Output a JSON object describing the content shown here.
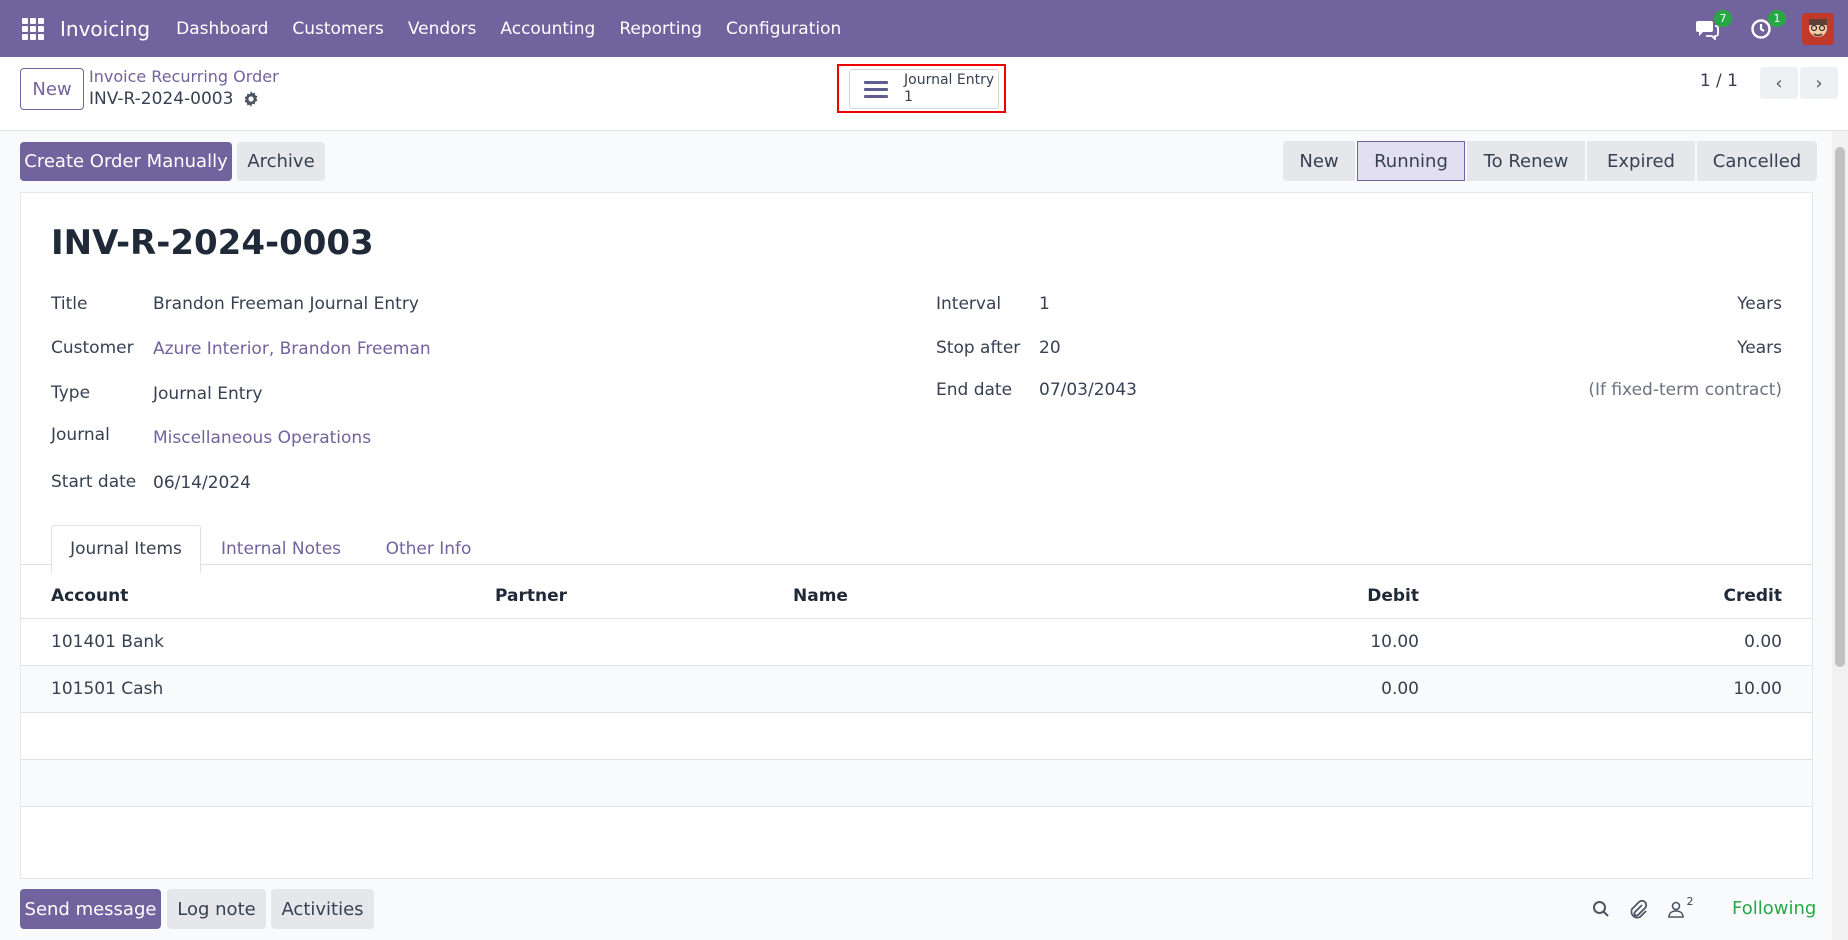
{
  "navbar": {
    "brand": "Invoicing",
    "menu": [
      "Dashboard",
      "Customers",
      "Vendors",
      "Accounting",
      "Reporting",
      "Configuration"
    ],
    "messages_count": "7",
    "activities_count": "1",
    "color": "#71639e"
  },
  "control_panel": {
    "new_label": "New",
    "breadcrumb": "Invoice Recurring Order",
    "record_name": "INV-R-2024-0003",
    "smart_button": {
      "label": "Journal Entry",
      "count": "1"
    },
    "pager": "1 / 1"
  },
  "actions": {
    "create_order": "Create Order Manually",
    "archive": "Archive"
  },
  "statusbar": {
    "stages": [
      "New",
      "Running",
      "To Renew",
      "Expired",
      "Cancelled"
    ],
    "active": "Running"
  },
  "form": {
    "title": "INV-R-2024-0003",
    "left_fields": [
      {
        "label": "Title",
        "value": "Brandon Freeman Journal Entry"
      },
      {
        "label": "Customer",
        "value": "Azure Interior, Brandon Freeman"
      },
      {
        "label": "Type",
        "value": "Journal Entry"
      },
      {
        "label": "Journal",
        "value": "Miscellaneous Operations"
      },
      {
        "label": "Start date",
        "value": "06/14/2024"
      }
    ],
    "right_fields": [
      {
        "label": "Interval",
        "value": "1",
        "unit": "Years"
      },
      {
        "label": "Stop after",
        "value": "20",
        "unit": "Years"
      },
      {
        "label": "End date",
        "value": "07/03/2043",
        "unit": "(If fixed-term contract)"
      }
    ]
  },
  "tabs": [
    "Journal Items",
    "Internal Notes",
    "Other Info"
  ],
  "table": {
    "headers": [
      "Account",
      "Partner",
      "Name",
      "Debit",
      "Credit"
    ],
    "rows": [
      {
        "account": "101401 Bank",
        "partner": "",
        "name": "",
        "debit": "10.00",
        "credit": "0.00"
      },
      {
        "account": "101501 Cash",
        "partner": "",
        "name": "",
        "debit": "0.00",
        "credit": "10.00"
      }
    ]
  },
  "chatter": {
    "send_message": "Send message",
    "log_note": "Log note",
    "activities": "Activities",
    "followers_count": "2",
    "following": "Following"
  }
}
